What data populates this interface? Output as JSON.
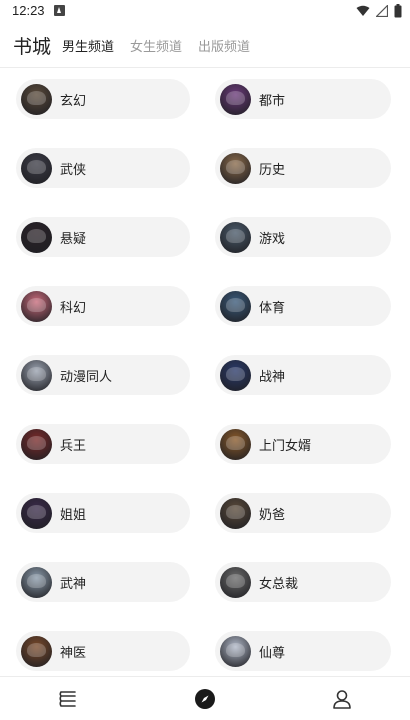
{
  "status_bar": {
    "time": "12:23",
    "notification_icon": "a-notification-icon",
    "icons": [
      "wifi-icon",
      "signal-icon",
      "battery-icon"
    ]
  },
  "header": {
    "title": "书城",
    "tabs": [
      {
        "label": "男生频道",
        "active": true
      },
      {
        "label": "女生频道",
        "active": false
      },
      {
        "label": "出版频道",
        "active": false
      }
    ]
  },
  "categories": [
    {
      "label": "玄幻",
      "cover_color": "#5a4a3a"
    },
    {
      "label": "都市",
      "cover_color": "#6b3a7a"
    },
    {
      "label": "武侠",
      "cover_color": "#3c3c46"
    },
    {
      "label": "历史",
      "cover_color": "#8a6a4a"
    },
    {
      "label": "悬疑",
      "cover_color": "#2a2228"
    },
    {
      "label": "游戏",
      "cover_color": "#4a5a6a"
    },
    {
      "label": "科幻",
      "cover_color": "#c86a7a"
    },
    {
      "label": "体育",
      "cover_color": "#3a5a7a"
    },
    {
      "label": "动漫同人",
      "cover_color": "#9aa2b0"
    },
    {
      "label": "战神",
      "cover_color": "#2a3a6a"
    },
    {
      "label": "兵王",
      "cover_color": "#7a2a2a"
    },
    {
      "label": "上门女婿",
      "cover_color": "#8a5a2a"
    },
    {
      "label": "姐姐",
      "cover_color": "#3a2a4a"
    },
    {
      "label": "奶爸",
      "cover_color": "#5a4a3a"
    },
    {
      "label": "武神",
      "cover_color": "#8a9aaa"
    },
    {
      "label": "女总裁",
      "cover_color": "#6a6a6a"
    },
    {
      "label": "神医",
      "cover_color": "#7a4a2a"
    },
    {
      "label": "仙尊",
      "cover_color": "#b0b8c8"
    }
  ],
  "bottom_nav": [
    {
      "name": "bookshelf-icon",
      "active": false
    },
    {
      "name": "discover-compass-icon",
      "active": true
    },
    {
      "name": "profile-icon",
      "active": false
    }
  ],
  "colors": {
    "pill_bg": "#f3f3f3",
    "active_text": "#222222",
    "inactive_text": "#9a9a9a"
  }
}
